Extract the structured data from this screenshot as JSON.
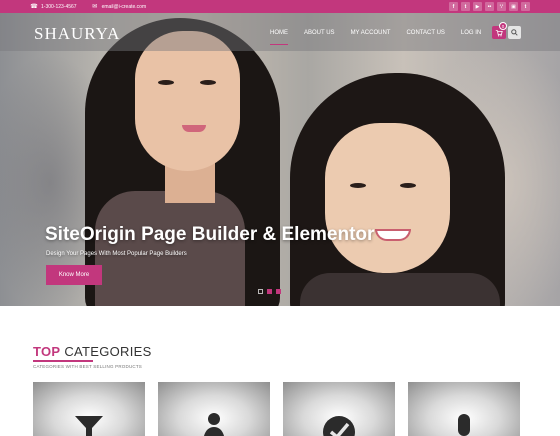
{
  "topbar": {
    "phone": "1-300-123-4567",
    "email": "email@i-create.com",
    "socials": [
      "facebook-icon",
      "twitter-icon",
      "youtube-icon",
      "flickr-icon",
      "rss-icon",
      "instagram-icon",
      "tumblr-icon"
    ]
  },
  "header": {
    "logo": "SHAURYA",
    "nav": [
      "HOME",
      "ABOUT US",
      "MY ACCOUNT",
      "CONTACT US",
      "LOG IN"
    ],
    "active_nav": "HOME",
    "cart_count": "0"
  },
  "hero": {
    "title": "SiteOrigin Page Builder & Elementor",
    "subtitle": "Design Your Pages With Most Popular Page Builders",
    "button": "Know More",
    "slides": 3,
    "active_slide": 2
  },
  "categories": {
    "title_accent": "TOP",
    "title_rest": "CATEGORIES",
    "subtitle": "CATEGORIES WITH BEST SELLING PRODUCTS",
    "items": [
      {
        "icon": "filter-icon"
      },
      {
        "icon": "person-icon"
      },
      {
        "icon": "check-badge-icon"
      },
      {
        "icon": "microphone-icon"
      }
    ]
  },
  "colors": {
    "accent": "#c2377d",
    "topbar": "#c2377d",
    "text_dark": "#333333"
  }
}
